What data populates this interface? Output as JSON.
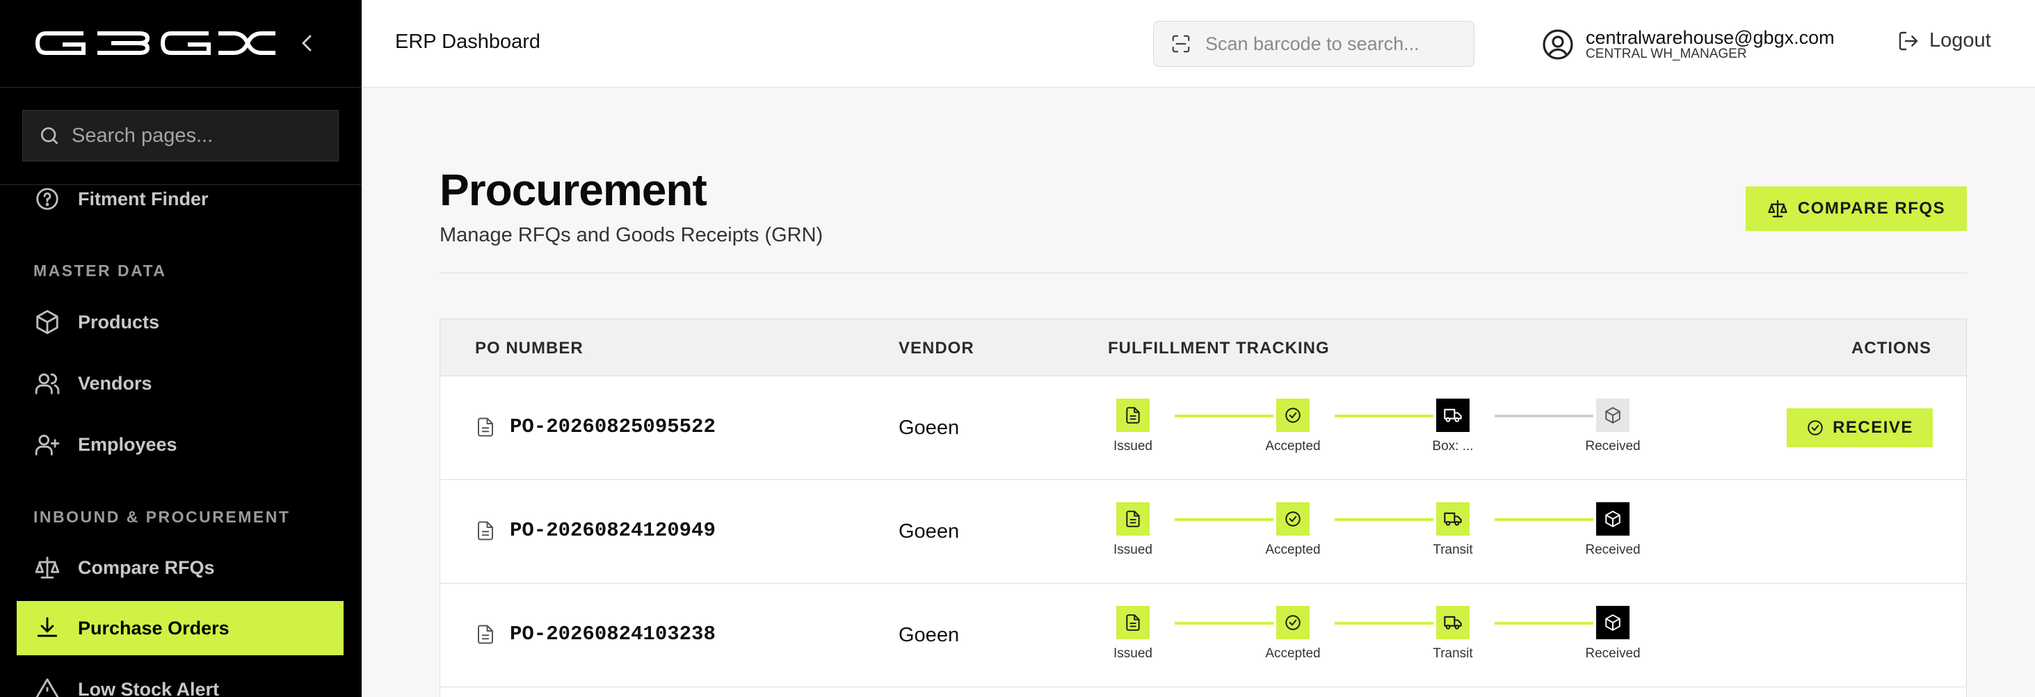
{
  "sidebar": {
    "search_placeholder": "Search pages...",
    "items": [
      {
        "label": "Fitment Finder",
        "icon": "help-circle-icon"
      },
      {
        "label": "Products",
        "icon": "box-icon"
      },
      {
        "label": "Vendors",
        "icon": "users-icon"
      },
      {
        "label": "Employees",
        "icon": "user-plus-icon"
      },
      {
        "label": "Compare RFQs",
        "icon": "scale-icon"
      },
      {
        "label": "Purchase Orders",
        "icon": "download-icon",
        "active": true
      },
      {
        "label": "Low Stock Alert",
        "icon": "alert-triangle-icon"
      }
    ],
    "sections": [
      "MASTER DATA",
      "INBOUND & PROCUREMENT"
    ]
  },
  "topbar": {
    "title": "ERP Dashboard",
    "search_placeholder": "Scan barcode to search...",
    "user_email": "centralwarehouse@gbgx.com",
    "user_role": "CENTRAL WH_MANAGER",
    "logout_label": "Logout"
  },
  "page": {
    "title": "Procurement",
    "subtitle": "Manage RFQs and Goods Receipts (GRN)",
    "compare_button": "COMPARE RFQS"
  },
  "table": {
    "headers": {
      "po": "PO NUMBER",
      "vendor": "VENDOR",
      "tracking": "FULFILLMENT TRACKING",
      "actions": "ACTIONS"
    },
    "rows": [
      {
        "po": "PO-20260825095522",
        "vendor": "Goeen",
        "steps": [
          "Issued",
          "Accepted",
          "Box: ...",
          "Received"
        ],
        "action": "RECEIVE"
      },
      {
        "po": "PO-20260824120949",
        "vendor": "Goeen",
        "steps": [
          "Issued",
          "Accepted",
          "Transit",
          "Received"
        ]
      },
      {
        "po": "PO-20260824103238",
        "vendor": "Goeen",
        "steps": [
          "Issued",
          "Accepted",
          "Transit",
          "Received"
        ]
      }
    ]
  },
  "colors": {
    "accent": "#cff244",
    "sidebar_bg": "#000000",
    "page_bg": "#f7f7f7"
  }
}
